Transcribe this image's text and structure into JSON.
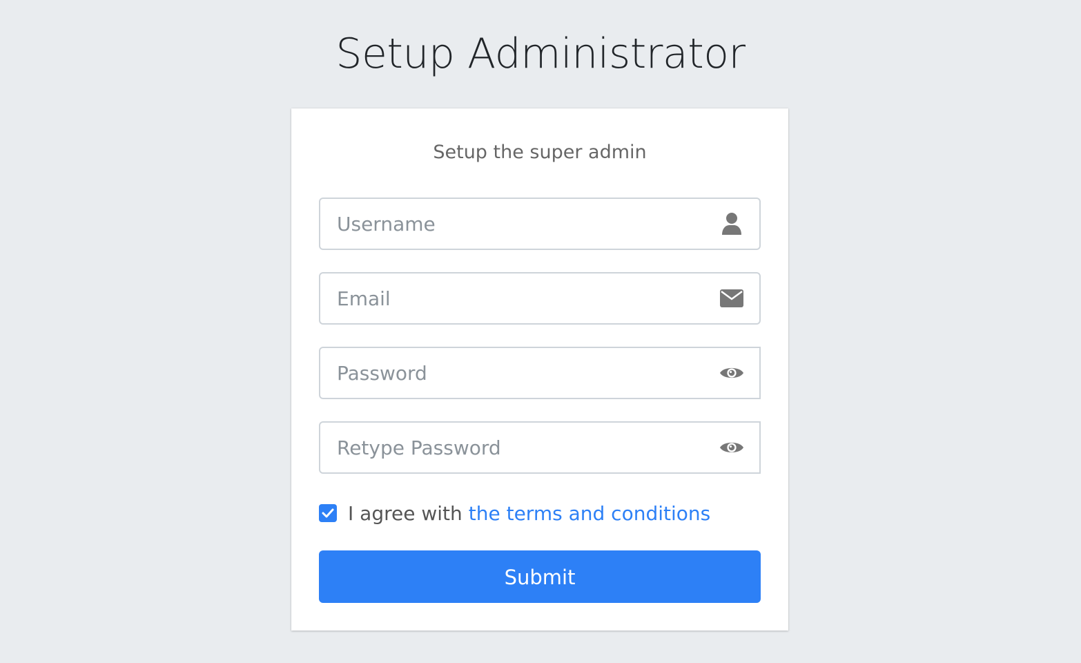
{
  "page": {
    "title": "Setup Administrator"
  },
  "card": {
    "subtitle": "Setup the super admin",
    "fields": {
      "username": {
        "placeholder": "Username",
        "value": "",
        "icon": "user-icon"
      },
      "email": {
        "placeholder": "Email",
        "value": "",
        "icon": "envelope-icon"
      },
      "password": {
        "placeholder": "Password",
        "value": "",
        "icon": "eye-icon"
      },
      "retype_password": {
        "placeholder": "Retype Password",
        "value": "",
        "icon": "eye-icon"
      }
    },
    "agree": {
      "checked": true,
      "text": "I agree with",
      "link_text": "the terms and conditions"
    },
    "submit_label": "Submit"
  },
  "colors": {
    "background": "#e9ecef",
    "accent": "#2d80f6",
    "icon": "#777777",
    "input_border": "#ced4da"
  }
}
